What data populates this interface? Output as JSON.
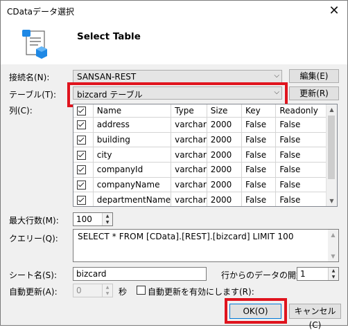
{
  "window": {
    "title": "CDataデータ選択",
    "close_glyph": "✕"
  },
  "header": {
    "heading": "Select Table"
  },
  "connection": {
    "label": "接続名(N):",
    "value": "SANSAN-REST",
    "edit_button": "編集(E)"
  },
  "table": {
    "label": "テーブル(T):",
    "value": "bizcard テーブル",
    "refresh_button": "更新(R)"
  },
  "columns": {
    "label": "列(C):",
    "headers": [
      "",
      "Name",
      "Type",
      "Size",
      "Key",
      "Readonly"
    ],
    "rows": [
      {
        "name": "address",
        "type": "varchar",
        "size": "2000",
        "key": "False",
        "readonly": "False"
      },
      {
        "name": "building",
        "type": "varchar",
        "size": "2000",
        "key": "False",
        "readonly": "False"
      },
      {
        "name": "city",
        "type": "varchar",
        "size": "2000",
        "key": "False",
        "readonly": "False"
      },
      {
        "name": "companyId",
        "type": "varchar",
        "size": "2000",
        "key": "False",
        "readonly": "False"
      },
      {
        "name": "companyName",
        "type": "varchar",
        "size": "2000",
        "key": "False",
        "readonly": "False"
      },
      {
        "name": "departmentName",
        "type": "varchar",
        "size": "2000",
        "key": "False",
        "readonly": "False"
      }
    ]
  },
  "max_rows": {
    "label": "最大行数(M):",
    "value": "100"
  },
  "query": {
    "label": "クエリー(Q):",
    "value": "SELECT * FROM [CData].[REST].[bizcard] LIMIT 100"
  },
  "sheet": {
    "label": "シート名(S):",
    "value": "bizcard",
    "start_row_label": "行からのデータの開始",
    "start_row_value": "1"
  },
  "auto_refresh": {
    "label": "自動更新(A):",
    "value": "0",
    "unit": "秒",
    "checkbox_label": "自動更新を有効にします(R):"
  },
  "footer": {
    "ok_button": "OK(O)",
    "cancel_button": "キャンセル(C)"
  },
  "colors": {
    "highlight": "#e0141e",
    "dialog_bg": "#f0f0f0",
    "icon_blue": "#1e88e5"
  }
}
